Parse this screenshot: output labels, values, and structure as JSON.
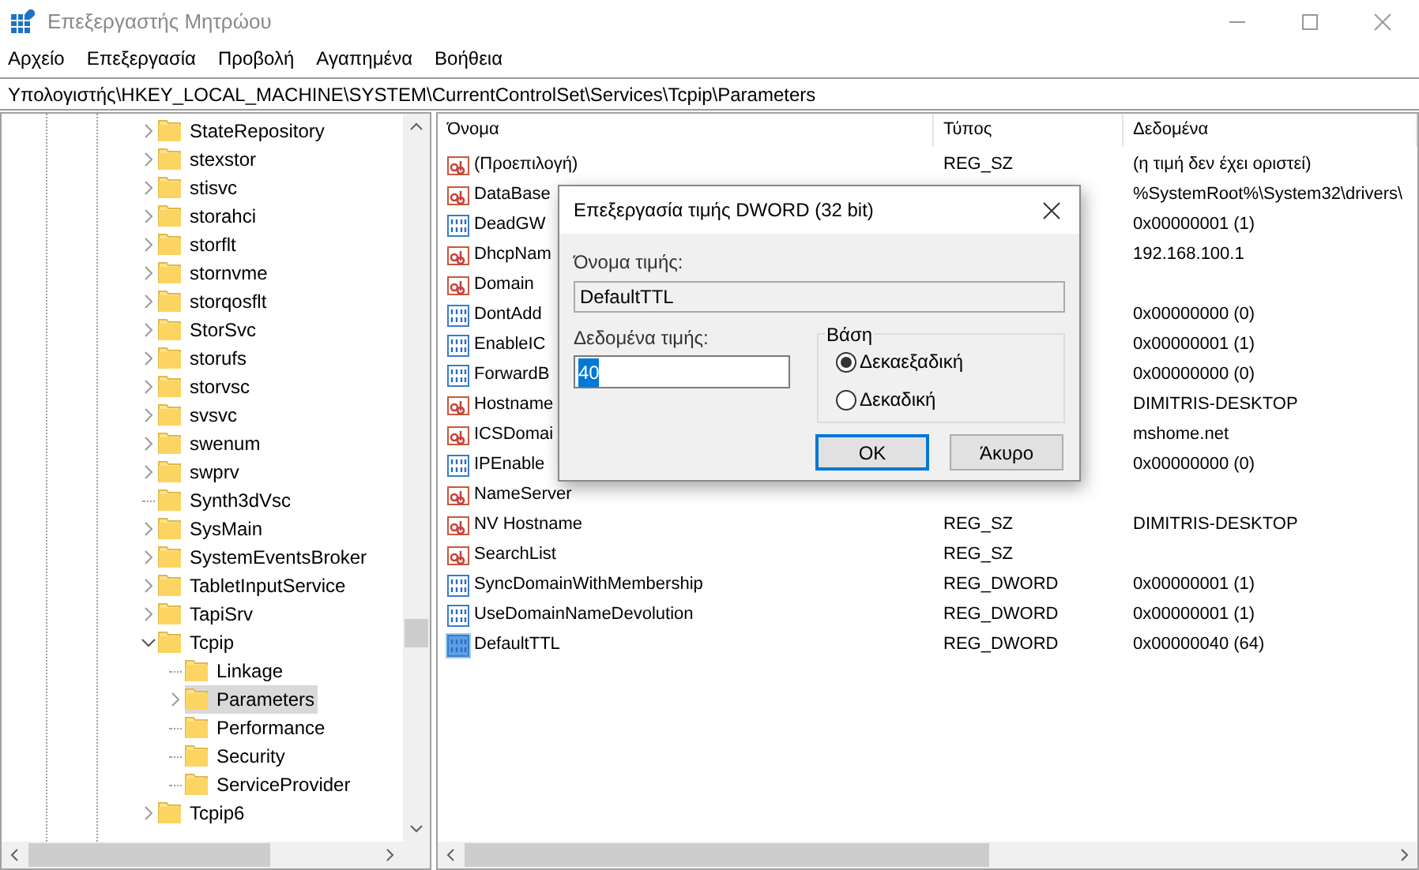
{
  "window": {
    "title": "Επεξεργαστής Μητρώου"
  },
  "menu": [
    "Αρχείο",
    "Επεξεργασία",
    "Προβολή",
    "Αγαπημένα",
    "Βοήθεια"
  ],
  "address": "Υπολογιστής\\HKEY_LOCAL_MACHINE\\SYSTEM\\CurrentControlSet\\Services\\Tcpip\\Parameters",
  "tree": [
    {
      "label": "StateRepository",
      "expandable": true,
      "expanded": false,
      "selected": false
    },
    {
      "label": "stexstor",
      "expandable": true,
      "expanded": false,
      "selected": false
    },
    {
      "label": "stisvc",
      "expandable": true,
      "expanded": false,
      "selected": false
    },
    {
      "label": "storahci",
      "expandable": true,
      "expanded": false,
      "selected": false
    },
    {
      "label": "storflt",
      "expandable": true,
      "expanded": false,
      "selected": false
    },
    {
      "label": "stornvme",
      "expandable": true,
      "expanded": false,
      "selected": false
    },
    {
      "label": "storqosflt",
      "expandable": true,
      "expanded": false,
      "selected": false
    },
    {
      "label": "StorSvc",
      "expandable": true,
      "expanded": false,
      "selected": false
    },
    {
      "label": "storufs",
      "expandable": true,
      "expanded": false,
      "selected": false
    },
    {
      "label": "storvsc",
      "expandable": true,
      "expanded": false,
      "selected": false
    },
    {
      "label": "svsvc",
      "expandable": true,
      "expanded": false,
      "selected": false
    },
    {
      "label": "swenum",
      "expandable": true,
      "expanded": false,
      "selected": false
    },
    {
      "label": "swprv",
      "expandable": true,
      "expanded": false,
      "selected": false
    },
    {
      "label": "Synth3dVsc",
      "expandable": false,
      "selected": false
    },
    {
      "label": "SysMain",
      "expandable": true,
      "expanded": false,
      "selected": false
    },
    {
      "label": "SystemEventsBroker",
      "expandable": true,
      "expanded": false,
      "selected": false
    },
    {
      "label": "TabletInputService",
      "expandable": true,
      "expanded": false,
      "selected": false
    },
    {
      "label": "TapiSrv",
      "expandable": true,
      "expanded": false,
      "selected": false
    },
    {
      "label": "Tcpip",
      "expandable": true,
      "expanded": true,
      "selected": false,
      "children": [
        {
          "label": "Linkage",
          "expandable": false,
          "selected": false
        },
        {
          "label": "Parameters",
          "expandable": true,
          "expanded": false,
          "selected": true
        },
        {
          "label": "Performance",
          "expandable": false,
          "selected": false
        },
        {
          "label": "Security",
          "expandable": false,
          "selected": false
        },
        {
          "label": "ServiceProvider",
          "expandable": false,
          "selected": false
        }
      ]
    },
    {
      "label": "Tcpip6",
      "expandable": true,
      "expanded": false,
      "selected": false
    }
  ],
  "list": {
    "columns": [
      "Όνομα",
      "Τύπος",
      "Δεδομένα"
    ],
    "rows": [
      {
        "kind": "sz",
        "name": "(Προεπιλογή)",
        "type": "REG_SZ",
        "data": "(η τιμή δεν έχει οριστεί)",
        "selected": false
      },
      {
        "kind": "sz",
        "name": "DataBase",
        "data": "%SystemRoot%\\System32\\drivers\\",
        "selected": false
      },
      {
        "kind": "dword",
        "name": "DeadGW",
        "data": "0x00000001 (1)",
        "selected": false
      },
      {
        "kind": "sz",
        "name": "DhcpNam",
        "data": "192.168.100.1",
        "selected": false
      },
      {
        "kind": "sz",
        "name": "Domain",
        "selected": false
      },
      {
        "kind": "dword",
        "name": "DontAdd",
        "data": "0x00000000 (0)",
        "selected": false
      },
      {
        "kind": "dword",
        "name": "EnableIC",
        "data": "0x00000001 (1)",
        "selected": false
      },
      {
        "kind": "dword",
        "name": "ForwardB",
        "data": "0x00000000 (0)",
        "selected": false
      },
      {
        "kind": "sz",
        "name": "Hostname",
        "data": "DIMITRIS-DESKTOP",
        "selected": false
      },
      {
        "kind": "sz",
        "name": "ICSDomai",
        "data": "mshome.net",
        "selected": false
      },
      {
        "kind": "dword",
        "name": "IPEnable",
        "data": "0x00000000 (0)",
        "selected": false
      },
      {
        "kind": "sz",
        "name": "NameServer",
        "selected": false
      },
      {
        "kind": "sz",
        "name": "NV Hostname",
        "type": "REG_SZ",
        "data": "DIMITRIS-DESKTOP",
        "selected": false
      },
      {
        "kind": "sz",
        "name": "SearchList",
        "type": "REG_SZ",
        "selected": false
      },
      {
        "kind": "dword",
        "name": "SyncDomainWithMembership",
        "type": "REG_DWORD",
        "data": "0x00000001 (1)",
        "selected": false
      },
      {
        "kind": "dword",
        "name": "UseDomainNameDevolution",
        "type": "REG_DWORD",
        "data": "0x00000001 (1)",
        "selected": false
      },
      {
        "kind": "dword",
        "name": "DefaultTTL",
        "type": "REG_DWORD",
        "data": "0x00000040 (64)",
        "selected": true
      }
    ]
  },
  "dialog": {
    "title": "Επεξεργασία τιμής DWORD (32 bit)",
    "name_label": "Όνομα τιμής:",
    "name_value": "DefaultTTL",
    "data_label": "Δεδομένα τιμής:",
    "data_value": "40",
    "base_label": "Βάση",
    "bases": [
      {
        "label": "Δεκαεξαδική",
        "selected": true
      },
      {
        "label": "Δεκαδική",
        "selected": false
      }
    ],
    "buttons": [
      {
        "label": "OK",
        "default": true
      },
      {
        "label": "Άκυρο",
        "default": false
      }
    ]
  }
}
